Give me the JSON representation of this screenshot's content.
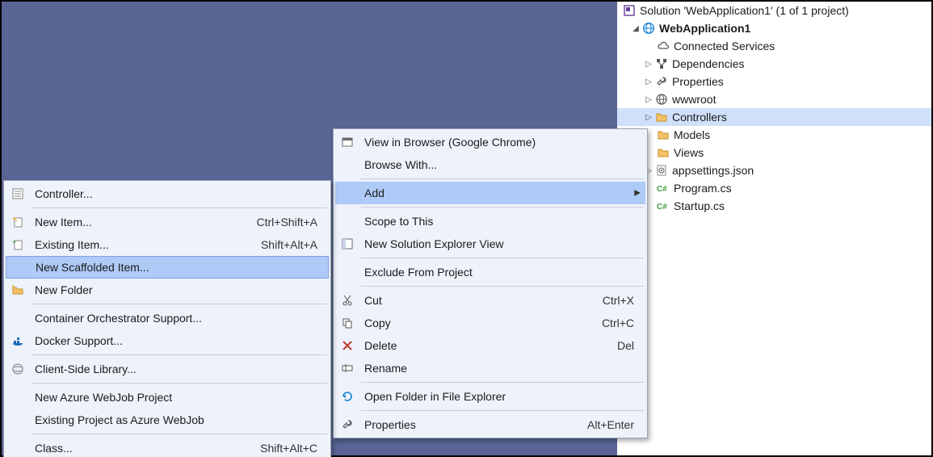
{
  "solution": {
    "title_prefix": "Solution '",
    "title_name": "WebApplication1",
    "title_count": "' (1 of 1 project)",
    "project": "WebApplication1",
    "nodes": {
      "connected_services": "Connected Services",
      "dependencies": "Dependencies",
      "properties": "Properties",
      "wwwroot": "wwwroot",
      "controllers": "Controllers",
      "models": "Models",
      "views": "Views",
      "appsettings": "appsettings.json",
      "program": "Program.cs",
      "startup": "Startup.cs"
    }
  },
  "menu1": {
    "view_in_browser": "View in Browser (Google Chrome)",
    "browse_with": "Browse With...",
    "add": "Add",
    "scope_to_this": "Scope to This",
    "new_solution_explorer_view": "New Solution Explorer View",
    "exclude_from_project": "Exclude From Project",
    "cut": "Cut",
    "cut_sc": "Ctrl+X",
    "copy": "Copy",
    "copy_sc": "Ctrl+C",
    "delete": "Delete",
    "delete_sc": "Del",
    "rename": "Rename",
    "open_folder": "Open Folder in File Explorer",
    "properties": "Properties",
    "properties_sc": "Alt+Enter"
  },
  "menu2": {
    "controller": "Controller...",
    "new_item": "New Item...",
    "new_item_sc": "Ctrl+Shift+A",
    "existing_item": "Existing Item...",
    "existing_item_sc": "Shift+Alt+A",
    "new_scaffolded_item": "New Scaffolded Item...",
    "new_folder": "New Folder",
    "container_orchestrator": "Container Orchestrator Support...",
    "docker_support": "Docker Support...",
    "client_side_library": "Client-Side Library...",
    "new_azure_webjob": "New Azure WebJob Project",
    "existing_project_webjob": "Existing Project as Azure WebJob",
    "class": "Class...",
    "class_sc": "Shift+Alt+C"
  }
}
